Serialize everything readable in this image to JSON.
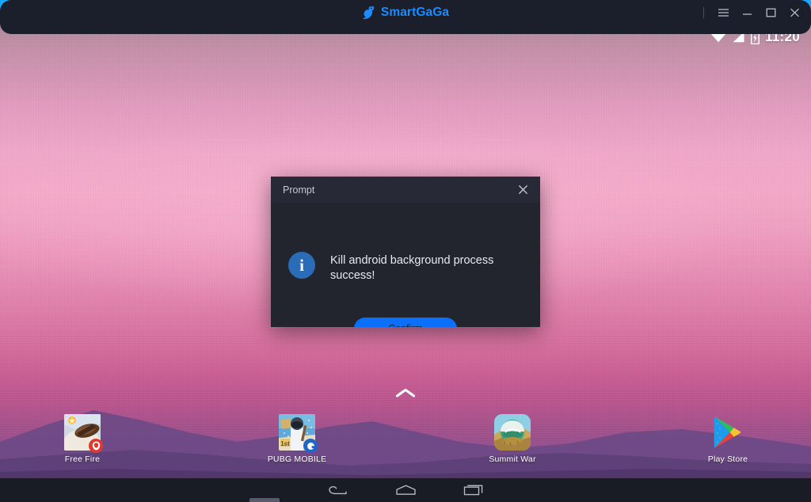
{
  "window": {
    "app_title": "SmartGaGa",
    "logo_icon": "swan-icon",
    "controls": [
      {
        "name": "menu-button",
        "icon": "hamburger-icon"
      },
      {
        "name": "minimize-button",
        "icon": "minimize-icon"
      },
      {
        "name": "maximize-button",
        "icon": "maximize-icon"
      },
      {
        "name": "close-button",
        "icon": "close-icon"
      }
    ],
    "accent_color": "#1a8cff",
    "titlebar_color": "#1b1e2b"
  },
  "status_bar": {
    "wifi_icon": "wifi-icon",
    "signal_icon": "cellular-signal-icon",
    "battery_icon": "battery-charging-icon",
    "time": "11:20"
  },
  "home": {
    "drawer_handle_icon": "chevron-up-icon",
    "wallpaper": {
      "sky_top": "#b08a9c",
      "sky_mid": "#f3a9c8",
      "sky_low": "#c75c92",
      "mountain": "#6d4a86"
    },
    "apps": [
      {
        "label": "Free Fire",
        "icon": "free-fire-icon",
        "badge": "garena-badge"
      },
      {
        "label": "PUBG MOBILE",
        "icon": "pubg-mobile-icon",
        "badge": "tencent-badge"
      },
      {
        "label": "Summit War",
        "icon": "summit-war-icon",
        "badge": ""
      },
      {
        "label": "Play Store",
        "icon": "play-store-icon",
        "badge": ""
      }
    ]
  },
  "nav_bar": {
    "buttons": [
      {
        "name": "back-button",
        "icon": "back-arrow-icon"
      },
      {
        "name": "home-button",
        "icon": "home-icon"
      },
      {
        "name": "recents-button",
        "icon": "recent-apps-icon"
      }
    ]
  },
  "dialog": {
    "title": "Prompt",
    "close_icon": "close-icon",
    "info_icon": "info-circle-icon",
    "message": "Kill android background process success!",
    "confirm_label": "Confirm",
    "confirm_color": "#0a6ffb",
    "body_color": "#22242e"
  }
}
